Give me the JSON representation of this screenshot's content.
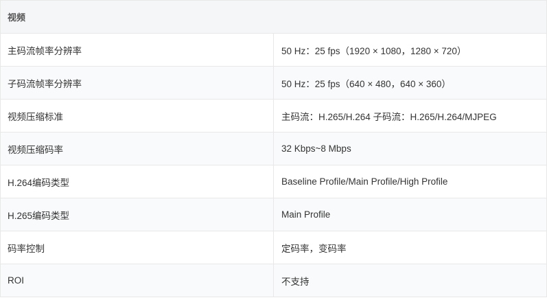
{
  "section_title": "视频",
  "rows": [
    {
      "label": "主码流帧率分辨率",
      "value": "50 Hz：25 fps（1920 × 1080，1280 × 720）"
    },
    {
      "label": "子码流帧率分辨率",
      "value": "50 Hz：25 fps（640 × 480，640 × 360）"
    },
    {
      "label": "视频压缩标准",
      "value": "主码流：H.265/H.264 子码流：H.265/H.264/MJPEG"
    },
    {
      "label": "视频压缩码率",
      "value": "32 Kbps~8 Mbps"
    },
    {
      "label": "H.264编码类型",
      "value": "Baseline Profile/Main Profile/High Profile"
    },
    {
      "label": "H.265编码类型",
      "value": "Main Profile"
    },
    {
      "label": "码率控制",
      "value": "定码率，变码率"
    },
    {
      "label": "ROI",
      "value": "不支持"
    }
  ]
}
